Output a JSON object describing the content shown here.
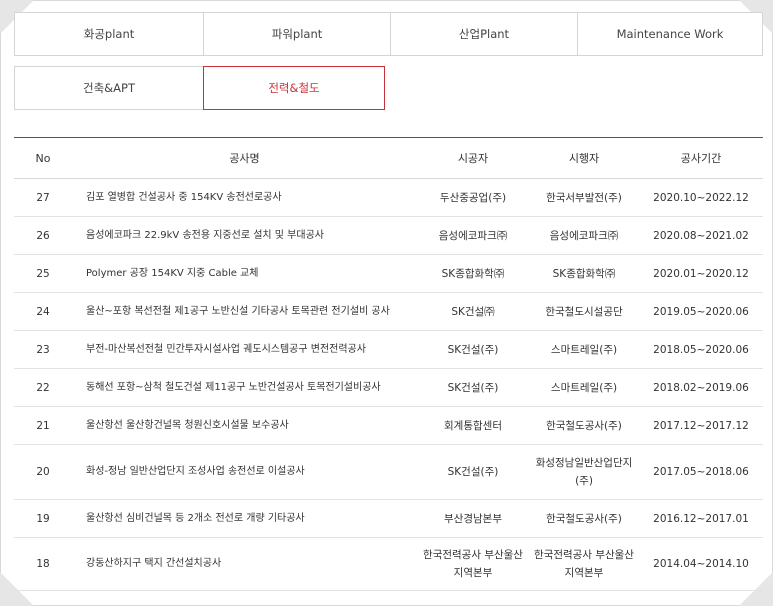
{
  "tabs": [
    {
      "label": "화공plant",
      "active": false
    },
    {
      "label": "파워plant",
      "active": false
    },
    {
      "label": "산업Plant",
      "active": false
    },
    {
      "label": "Maintenance Work",
      "active": false
    },
    {
      "label": "건축&APT",
      "active": false
    },
    {
      "label": "전력&철도",
      "active": true
    }
  ],
  "colors": {
    "accent": "#c8323b",
    "border": "#d5d5d5"
  },
  "table": {
    "headers": {
      "no": "No",
      "name": "공사명",
      "contractor": "시공자",
      "client": "시행자",
      "period": "공사기간"
    },
    "rows": [
      {
        "no": "27",
        "name": "김포 열병합 건설공사 중 154KV 송전선로공사",
        "contractor": "두산중공업(주)",
        "client": "한국서부발전(주)",
        "period": "2020.10~2022.12"
      },
      {
        "no": "26",
        "name": "음성에코파크 22.9kV 송전용 지중선로 설치 및 부대공사",
        "contractor": "음성에코파크㈜",
        "client": "음성에코파크㈜",
        "period": "2020.08~2021.02"
      },
      {
        "no": "25",
        "name": "Polymer 공장 154KV 지중 Cable 교체",
        "contractor": "SK종합화학㈜",
        "client": "SK종합화학㈜",
        "period": "2020.01~2020.12"
      },
      {
        "no": "24",
        "name": "울산~포항 복선전철 제1공구 노반신설 기타공사 토목관련 전기설비 공사",
        "contractor": "SK건설㈜",
        "client": "한국철도시설공단",
        "period": "2019.05~2020.06"
      },
      {
        "no": "23",
        "name": "부전-마산복선전철 민간투자시설사업 궤도시스템공구 변전전력공사",
        "contractor": "SK건설(주)",
        "client": "스마트레일(주)",
        "period": "2018.05~2020.06"
      },
      {
        "no": "22",
        "name": "동해선 포항~삼척 철도건설 제11공구 노반건설공사 토목전기설비공사",
        "contractor": "SK건설(주)",
        "client": "스마트레일(주)",
        "period": "2018.02~2019.06"
      },
      {
        "no": "21",
        "name": "울산항선 울산항건널목 청원신호시설물 보수공사",
        "contractor": "회계통합센터",
        "client": "한국철도공사(주)",
        "period": "2017.12~2017.12"
      },
      {
        "no": "20",
        "name": "화성-정남 일반산업단지 조성사업 송전선로 이설공사",
        "contractor": "SK건설(주)",
        "client": "화성정남일반산업단지(주)",
        "period": "2017.05~2018.06"
      },
      {
        "no": "19",
        "name": "울산항선 심비건널목 등 2개소 전선로 개량 기타공사",
        "contractor": "부산경남본부",
        "client": "한국철도공사(주)",
        "period": "2016.12~2017.01"
      },
      {
        "no": "18",
        "name": "강동산하지구 택지 간선설치공사",
        "contractor": "한국전력공사 부산울산지역본부",
        "client": "한국전력공사 부산울산지역본부",
        "period": "2014.04~2014.10"
      }
    ]
  }
}
